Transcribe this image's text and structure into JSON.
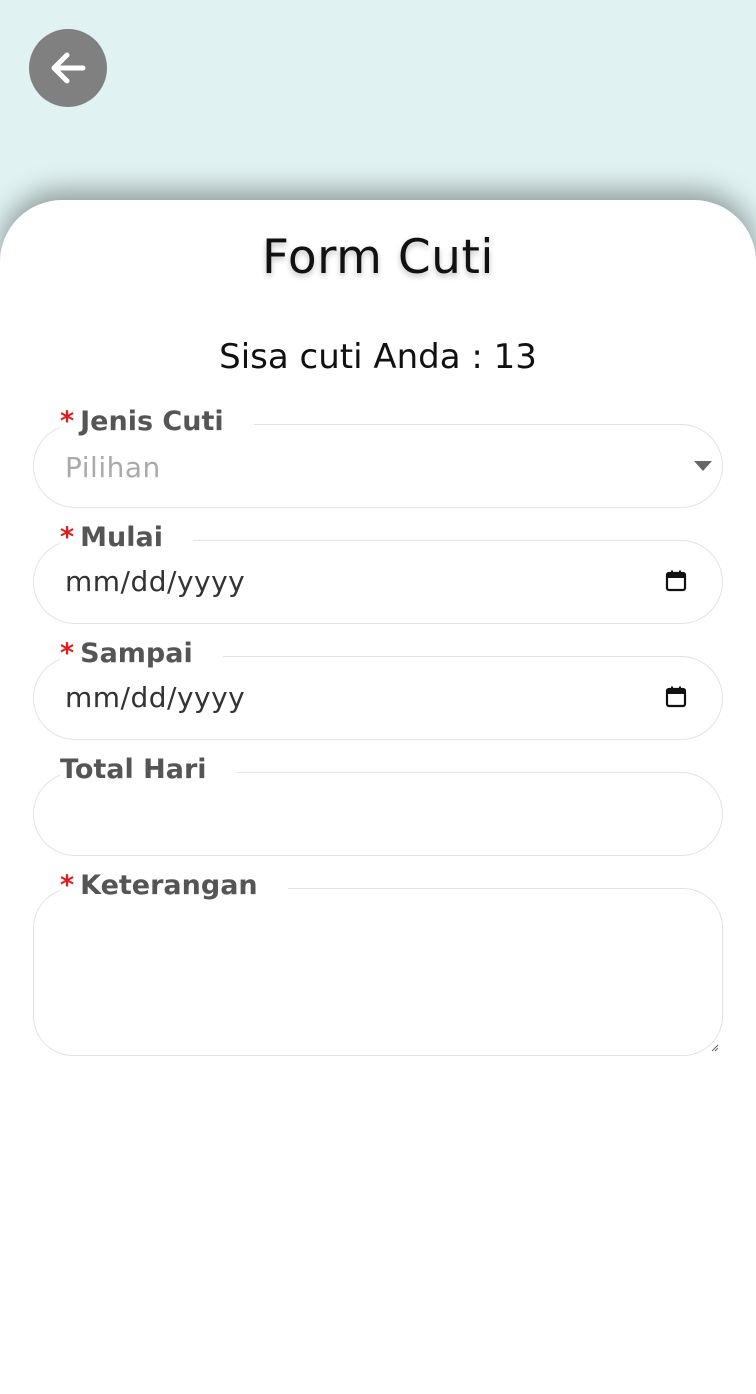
{
  "header": {
    "back_icon": "arrow-left-icon"
  },
  "form": {
    "title": "Form Cuti",
    "quota_text": "Sisa cuti Anda : 13",
    "required_mark": "*",
    "fields": {
      "jenis": {
        "label": "Jenis Cuti",
        "placeholder": "Pilihan",
        "required": true
      },
      "mulai": {
        "label": "Mulai",
        "value": "mm/dd/yyyy",
        "required": true
      },
      "sampai": {
        "label": "Sampai",
        "value": "mm/dd/yyyy",
        "required": true
      },
      "total": {
        "label": "Total Hari",
        "value": "",
        "required": false
      },
      "keterangan": {
        "label": "Keterangan",
        "value": "",
        "required": true
      }
    }
  },
  "colors": {
    "background": "#e0f2f2",
    "required": "#e01b1b",
    "back_button": "#808080"
  }
}
